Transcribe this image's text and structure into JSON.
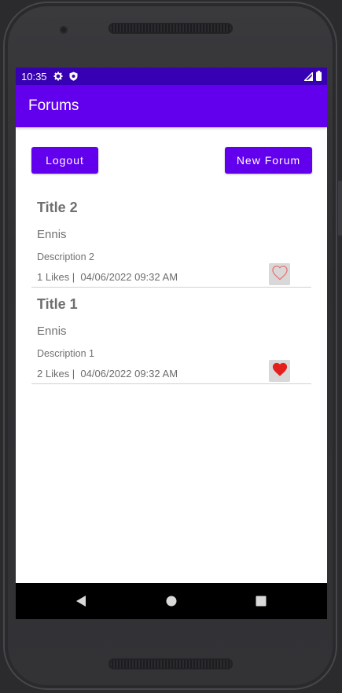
{
  "status_bar": {
    "time": "10:35",
    "icons": [
      "settings-icon",
      "shield-icon"
    ],
    "right_icons": [
      "signal-icon",
      "battery-icon"
    ]
  },
  "app_bar": {
    "title": "Forums"
  },
  "actions": {
    "logout_label": "Logout",
    "new_forum_label": "New Forum"
  },
  "forums": [
    {
      "title": "Title 2",
      "author": "Ennis",
      "description": "Description 2",
      "likes": "1",
      "likes_label": " Likes |  ",
      "date": "04/06/2022 09:32 AM",
      "liked": false
    },
    {
      "title": "Title 1",
      "author": "Ennis",
      "description": "Description 1",
      "likes": "2",
      "likes_label": " Likes |  ",
      "date": "04/06/2022 09:32 AM",
      "liked": true
    }
  ],
  "colors": {
    "status_bar": "#3700b3",
    "primary": "#6200ee",
    "heart_filled": "#e5201c",
    "heart_outline": "#ef6b6b"
  },
  "nav": {
    "icons": [
      "back-icon",
      "home-icon",
      "recents-icon"
    ]
  }
}
